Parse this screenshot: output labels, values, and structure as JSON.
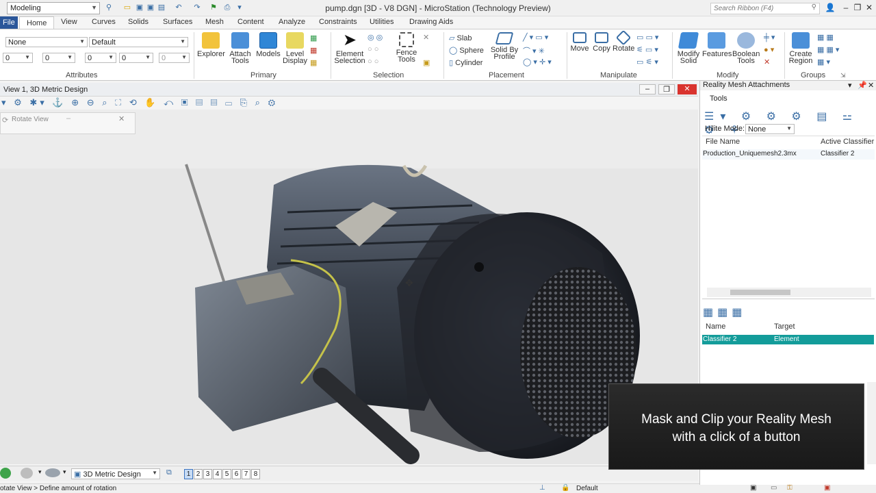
{
  "titlebar": {
    "workflow": "Modeling",
    "title": "pump.dgn [3D - V8 DGN] - MicroStation (Technology Preview)",
    "search_placeholder": "Search Ribbon (F4)"
  },
  "tabs": [
    "File",
    "Home",
    "View",
    "Curves",
    "Solids",
    "Surfaces",
    "Mesh",
    "Content",
    "Analyze",
    "Constraints",
    "Utilities",
    "Drawing Aids"
  ],
  "attributes": {
    "level": "None",
    "style": "Default",
    "row2": [
      "0",
      "0",
      "0",
      "0",
      "0"
    ],
    "label": "Attributes"
  },
  "primary": {
    "label": "Primary",
    "buttons": [
      "Explorer",
      "Attach",
      "Tools",
      "Models",
      "Level",
      "Display"
    ]
  },
  "selection": {
    "label": "Selection",
    "element": "Element",
    "element2": "Selection",
    "fence": "Fence",
    "fence2": "Tools"
  },
  "placement": {
    "label": "Placement",
    "slab": "Slab",
    "sphere": "Sphere",
    "cylinder": "Cylinder",
    "solid_by": "Solid By",
    "profile": "Profile"
  },
  "manipulate": {
    "label": "Manipulate",
    "move": "Move",
    "copy": "Copy",
    "rotate": "Rotate"
  },
  "modify": {
    "label": "Modify",
    "modify": "Modify",
    "solid": "Solid",
    "features": "Features",
    "boolean": "Boolean",
    "tools": "Tools"
  },
  "groups": {
    "label": "Groups",
    "create": "Create",
    "region": "Region"
  },
  "view": {
    "title": "View 1, 3D Metric Design",
    "rotate_popup": "Rotate View",
    "model": "3D Metric Design",
    "view_numbers": [
      "1",
      "2",
      "3",
      "4",
      "5",
      "6",
      "7",
      "8"
    ]
  },
  "status": {
    "prompt": "otate View > Define amount of rotation",
    "level": "Default"
  },
  "panel": {
    "title": "Reality Mesh Attachments",
    "tools": "Tools",
    "hilite_label": "Hilite Mode:",
    "hilite_value": "None",
    "col_file": "File Name",
    "col_classifier": "Active Classifier",
    "file_name": "Production_Uniquemesh2.3mx",
    "classifier": "Classifier 2",
    "col_name": "Name",
    "col_target": "Target",
    "row_name": "Classifier 2",
    "row_target": "Element"
  },
  "overlay": {
    "line1": "Mask and Clip your Reality Mesh",
    "line2": "with a click of a button"
  }
}
